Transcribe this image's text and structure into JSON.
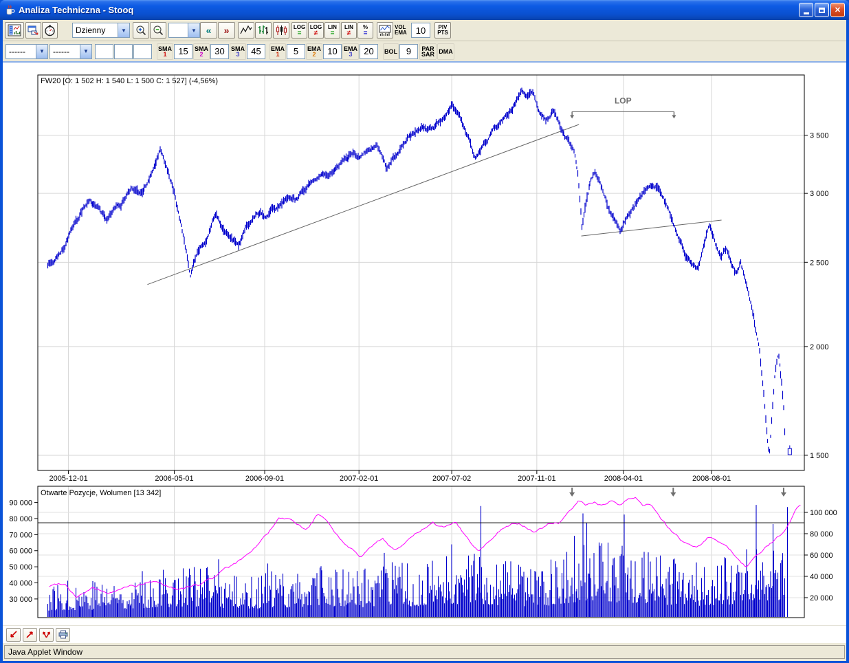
{
  "window": {
    "title": "Analiza Techniczna - Stooq",
    "status_bar": "Java Applet Window"
  },
  "toolbar_top": {
    "interval_select_value": "Dzienny",
    "zoom_select_value": "",
    "nav_back": "«",
    "nav_fwd": "»",
    "nav_back_color": "#007b7b",
    "nav_fwd_color": "#9b1111",
    "scale_buttons": [
      {
        "label": "LOG",
        "symbol": "=",
        "symbol_color": "#009900"
      },
      {
        "label": "LOG",
        "symbol": "≠",
        "symbol_color": "#cc0000"
      },
      {
        "label": "LIN",
        "symbol": "=",
        "symbol_color": "#009900"
      },
      {
        "label": "LIN",
        "symbol": "≠",
        "symbol_color": "#cc0000"
      },
      {
        "label": "%",
        "symbol": "=",
        "symbol_color": "#0000cc"
      }
    ],
    "vol_ema": {
      "line1": "VOL",
      "line2": "EMA",
      "value": "10"
    },
    "piv": {
      "line1": "PIV",
      "line2": "PTS"
    }
  },
  "toolbar_indicators": {
    "select1_value": "------",
    "select2_value": "------",
    "free_inputs": [
      "",
      "",
      ""
    ],
    "sma": [
      {
        "label": "SMA",
        "index": "1",
        "color": "#cc0000",
        "value": "15"
      },
      {
        "label": "SMA",
        "index": "2",
        "color": "#cc00cc",
        "value": "30"
      },
      {
        "label": "SMA",
        "index": "3",
        "color": "#4444cc",
        "value": "45"
      }
    ],
    "ema": [
      {
        "label": "EMA",
        "index": "1",
        "color": "#cc2200",
        "value": "5"
      },
      {
        "label": "EMA",
        "index": "2",
        "color": "#dd7700",
        "value": "10"
      },
      {
        "label": "EMA",
        "index": "3",
        "color": "#4444cc",
        "value": "20"
      }
    ],
    "bol": {
      "label": "BOL",
      "value": "9"
    },
    "parsar": {
      "line1": "PAR",
      "line2": "SAR"
    },
    "dma": {
      "label": "DMA"
    }
  },
  "chart_data": [
    {
      "type": "candlestick",
      "title": "FW20 [O: 1 502  H: 1 540  L: 1 500  C: 1 527] (-4,56%)",
      "symbol": "FW20",
      "last_bar": {
        "open": 1502,
        "high": 1540,
        "low": 1500,
        "close": 1527,
        "change": "-4,56%"
      },
      "scale": "log",
      "series_color": "#0000cc",
      "ylim": [
        1441,
        4104
      ],
      "y_ticks": [
        {
          "value": 3500,
          "label": "3 500"
        },
        {
          "value": 3000,
          "label": "3 000"
        },
        {
          "value": 2500,
          "label": "2 500"
        },
        {
          "value": 2000,
          "label": "2 000"
        },
        {
          "value": 1500,
          "label": "1 500"
        }
      ],
      "x_ticks": [
        {
          "label": "2005-12-01",
          "frac": 0.04
        },
        {
          "label": "2006-05-01",
          "frac": 0.178
        },
        {
          "label": "2006-09-01",
          "frac": 0.296
        },
        {
          "label": "2007-02-01",
          "frac": 0.419
        },
        {
          "label": "2007-07-02",
          "frac": 0.54
        },
        {
          "label": "2007-11-01",
          "frac": 0.651
        },
        {
          "label": "2008-04-01",
          "frac": 0.764
        },
        {
          "label": "2008-08-01",
          "frac": 0.879
        }
      ],
      "price_path": [
        [
          0.013,
          2470
        ],
        [
          0.022,
          2520
        ],
        [
          0.034,
          2600
        ],
        [
          0.046,
          2720
        ],
        [
          0.058,
          2850
        ],
        [
          0.068,
          2940
        ],
        [
          0.078,
          2880
        ],
        [
          0.09,
          2800
        ],
        [
          0.1,
          2880
        ],
        [
          0.112,
          2960
        ],
        [
          0.122,
          3040
        ],
        [
          0.132,
          2990
        ],
        [
          0.142,
          3080
        ],
        [
          0.152,
          3200
        ],
        [
          0.16,
          3340
        ],
        [
          0.168,
          3180
        ],
        [
          0.178,
          3000
        ],
        [
          0.188,
          2700
        ],
        [
          0.199,
          2390
        ],
        [
          0.208,
          2550
        ],
        [
          0.22,
          2680
        ],
        [
          0.232,
          2840
        ],
        [
          0.24,
          2760
        ],
        [
          0.252,
          2700
        ],
        [
          0.262,
          2660
        ],
        [
          0.272,
          2800
        ],
        [
          0.285,
          2890
        ],
        [
          0.298,
          2880
        ],
        [
          0.312,
          2950
        ],
        [
          0.326,
          3030
        ],
        [
          0.338,
          2990
        ],
        [
          0.352,
          3090
        ],
        [
          0.366,
          3160
        ],
        [
          0.378,
          3120
        ],
        [
          0.392,
          3220
        ],
        [
          0.406,
          3330
        ],
        [
          0.418,
          3300
        ],
        [
          0.43,
          3390
        ],
        [
          0.442,
          3460
        ],
        [
          0.455,
          3260
        ],
        [
          0.465,
          3330
        ],
        [
          0.477,
          3420
        ],
        [
          0.49,
          3520
        ],
        [
          0.503,
          3580
        ],
        [
          0.515,
          3540
        ],
        [
          0.528,
          3660
        ],
        [
          0.541,
          3800
        ],
        [
          0.552,
          3680
        ],
        [
          0.563,
          3480
        ],
        [
          0.571,
          3340
        ],
        [
          0.582,
          3490
        ],
        [
          0.592,
          3560
        ],
        [
          0.603,
          3640
        ],
        [
          0.614,
          3720
        ],
        [
          0.624,
          3870
        ],
        [
          0.631,
          3950
        ],
        [
          0.638,
          3840
        ],
        [
          0.645,
          3890
        ],
        [
          0.654,
          3720
        ],
        [
          0.663,
          3630
        ],
        [
          0.673,
          3700
        ],
        [
          0.683,
          3560
        ],
        [
          0.692,
          3440
        ],
        [
          0.7,
          3300
        ],
        [
          0.705,
          3100
        ],
        [
          0.71,
          2700
        ],
        [
          0.716,
          2900
        ],
        [
          0.722,
          3060
        ],
        [
          0.727,
          3120
        ],
        [
          0.734,
          3010
        ],
        [
          0.741,
          2930
        ],
        [
          0.748,
          2800
        ],
        [
          0.755,
          2770
        ],
        [
          0.76,
          2720
        ],
        [
          0.768,
          2860
        ],
        [
          0.779,
          2950
        ],
        [
          0.79,
          3000
        ],
        [
          0.801,
          3080
        ],
        [
          0.81,
          3040
        ],
        [
          0.82,
          2930
        ],
        [
          0.828,
          2820
        ],
        [
          0.836,
          2680
        ],
        [
          0.845,
          2570
        ],
        [
          0.855,
          2470
        ],
        [
          0.861,
          2430
        ],
        [
          0.868,
          2580
        ],
        [
          0.876,
          2780
        ],
        [
          0.884,
          2650
        ],
        [
          0.891,
          2560
        ],
        [
          0.898,
          2620
        ],
        [
          0.905,
          2520
        ],
        [
          0.911,
          2450
        ],
        [
          0.917,
          2520
        ],
        [
          0.924,
          2380
        ],
        [
          0.93,
          2250
        ],
        [
          0.936,
          2100
        ],
        [
          0.942,
          1950
        ],
        [
          0.947,
          1750
        ],
        [
          0.952,
          1560
        ],
        [
          0.9545,
          1490
        ],
        [
          0.958,
          1650
        ],
        [
          0.962,
          1850
        ],
        [
          0.966,
          1930
        ],
        [
          0.97,
          1800
        ],
        [
          0.973,
          1680
        ],
        [
          0.9745,
          1560
        ]
      ],
      "last_bar_frac": 0.981,
      "trendlines": [
        {
          "x1": 0.143,
          "p1": 2357,
          "x2": 0.706,
          "p2": 3600
        },
        {
          "x1": 0.709,
          "p1": 2680,
          "x2": 0.892,
          "p2": 2795
        }
      ],
      "annotation": {
        "label": "LOP",
        "x1": 0.697,
        "x2": 0.83,
        "price": 3724,
        "color": "#6e6e6e"
      }
    },
    {
      "type": "bar+line",
      "title": "Otwarte Pozycje, Wolumen [13 342]",
      "left_axis": {
        "series": "Otwarte Pozycje",
        "color": "#ff00ff",
        "ylim": [
          18400,
          100100
        ],
        "ticks": [
          {
            "value": 90000,
            "label": "90 000"
          },
          {
            "value": 80000,
            "label": "80 000"
          },
          {
            "value": 70000,
            "label": "70 000"
          },
          {
            "value": 60000,
            "label": "60 000"
          },
          {
            "value": 50000,
            "label": "50 000"
          },
          {
            "value": 40000,
            "label": "40 000"
          },
          {
            "value": 30000,
            "label": "30 000"
          }
        ]
      },
      "right_axis": {
        "series": "Wolumen",
        "color": "#0000cc",
        "ylim": [
          0,
          124500
        ],
        "ticks": [
          {
            "value": 100000,
            "label": "100 000"
          },
          {
            "value": 80000,
            "label": "80 000"
          },
          {
            "value": 60000,
            "label": "60 000"
          },
          {
            "value": 40000,
            "label": "40 000"
          },
          {
            "value": 20000,
            "label": "20 000"
          }
        ]
      },
      "lop_path": [
        [
          0.015,
          38000
        ],
        [
          0.035,
          40500
        ],
        [
          0.05,
          33500
        ],
        [
          0.07,
          38500
        ],
        [
          0.09,
          35000
        ],
        [
          0.12,
          38500
        ],
        [
          0.15,
          40500
        ],
        [
          0.18,
          36500
        ],
        [
          0.21,
          38500
        ],
        [
          0.24,
          47000
        ],
        [
          0.26,
          51000
        ],
        [
          0.28,
          60000
        ],
        [
          0.3,
          70500
        ],
        [
          0.315,
          79000
        ],
        [
          0.33,
          77000
        ],
        [
          0.35,
          70500
        ],
        [
          0.365,
          81000
        ],
        [
          0.38,
          75000
        ],
        [
          0.4,
          64000
        ],
        [
          0.42,
          58000
        ],
        [
          0.435,
          64000
        ],
        [
          0.45,
          68500
        ],
        [
          0.465,
          62000
        ],
        [
          0.48,
          66500
        ],
        [
          0.5,
          73000
        ],
        [
          0.515,
          76000
        ],
        [
          0.53,
          73000
        ],
        [
          0.545,
          78000
        ],
        [
          0.56,
          68500
        ],
        [
          0.575,
          60000
        ],
        [
          0.59,
          68500
        ],
        [
          0.605,
          76000
        ],
        [
          0.62,
          79000
        ],
        [
          0.635,
          76000
        ],
        [
          0.65,
          73000
        ],
        [
          0.665,
          78000
        ],
        [
          0.68,
          79000
        ],
        [
          0.695,
          85000
        ],
        [
          0.705,
          90000
        ],
        [
          0.715,
          87500
        ],
        [
          0.725,
          90500
        ],
        [
          0.735,
          88500
        ],
        [
          0.75,
          91500
        ],
        [
          0.76,
          87500
        ],
        [
          0.77,
          90000
        ],
        [
          0.78,
          90500
        ],
        [
          0.79,
          85500
        ],
        [
          0.8,
          87500
        ],
        [
          0.81,
          81500
        ],
        [
          0.82,
          75000
        ],
        [
          0.83,
          70500
        ],
        [
          0.845,
          64000
        ],
        [
          0.86,
          60000
        ],
        [
          0.875,
          66500
        ],
        [
          0.885,
          64000
        ],
        [
          0.9,
          60000
        ],
        [
          0.915,
          53500
        ],
        [
          0.925,
          49500
        ],
        [
          0.935,
          53500
        ],
        [
          0.95,
          60000
        ],
        [
          0.96,
          64000
        ],
        [
          0.97,
          68500
        ],
        [
          0.98,
          77000
        ],
        [
          0.99,
          88000
        ],
        [
          0.995,
          90500
        ]
      ],
      "volume_envelope": [
        [
          0.013,
          26000
        ],
        [
          0.05,
          28000
        ],
        [
          0.1,
          30000
        ],
        [
          0.16,
          36000
        ],
        [
          0.2,
          40000
        ],
        [
          0.25,
          32000
        ],
        [
          0.3,
          33000
        ],
        [
          0.36,
          38000
        ],
        [
          0.42,
          36000
        ],
        [
          0.46,
          40000
        ],
        [
          0.5,
          38000
        ],
        [
          0.54,
          46000
        ],
        [
          0.58,
          46000
        ],
        [
          0.62,
          40000
        ],
        [
          0.66,
          40000
        ],
        [
          0.7,
          52000
        ],
        [
          0.72,
          58000
        ],
        [
          0.75,
          52000
        ],
        [
          0.78,
          50000
        ],
        [
          0.82,
          44000
        ],
        [
          0.86,
          40000
        ],
        [
          0.9,
          44000
        ],
        [
          0.93,
          55000
        ],
        [
          0.95,
          58000
        ],
        [
          0.97,
          58000
        ],
        [
          0.98,
          60000
        ]
      ],
      "volume_spikes": [
        [
          0.236,
          56000
        ],
        [
          0.3,
          52000
        ],
        [
          0.452,
          62000
        ],
        [
          0.54,
          70000
        ],
        [
          0.578,
          106000
        ],
        [
          0.7,
          78000
        ],
        [
          0.711,
          99000
        ],
        [
          0.716,
          90000
        ],
        [
          0.765,
          98000
        ],
        [
          0.937,
          107000
        ],
        [
          0.959,
          89000
        ],
        [
          0.978,
          105000
        ]
      ],
      "level_line": {
        "value": 77400,
        "color": "#000000"
      },
      "markers": {
        "fracs": [
          0.697,
          0.829,
          0.973
        ],
        "color": "#6e6e6e"
      }
    }
  ],
  "bottom_toolbar": {
    "icons": [
      "arrow-down-left",
      "arrow-up-right",
      "arrows-up-both",
      "printer"
    ]
  }
}
